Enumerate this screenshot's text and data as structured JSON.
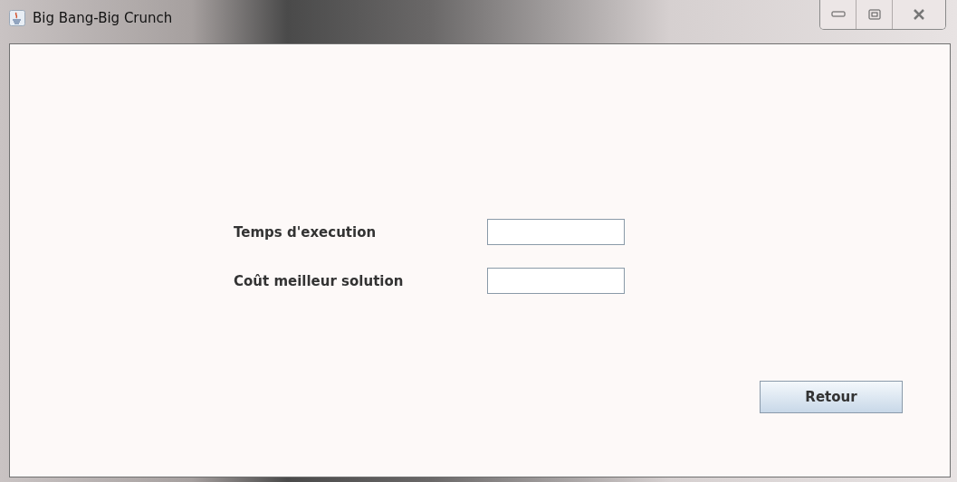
{
  "window": {
    "title": "Big Bang-Big Crunch"
  },
  "fields": [
    {
      "label": "Temps d'execution"
    },
    {
      "label": "Coût meilleur solution"
    }
  ],
  "buttons": [
    "Retour"
  ]
}
